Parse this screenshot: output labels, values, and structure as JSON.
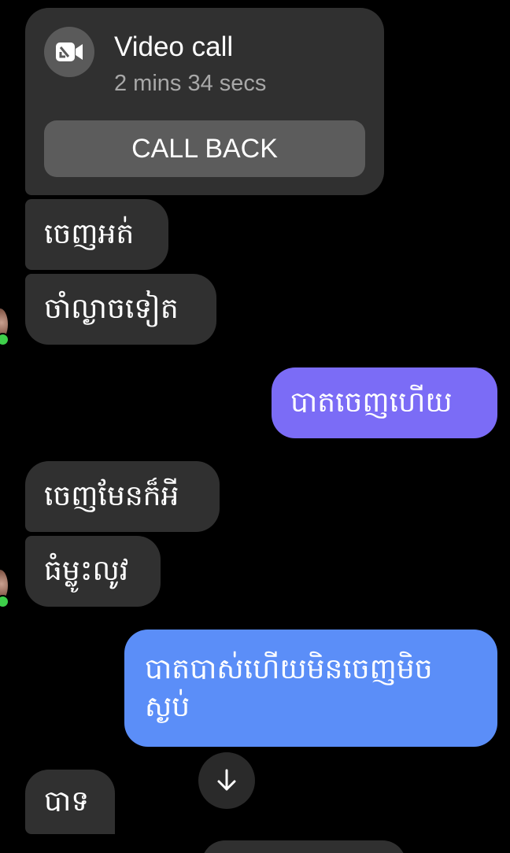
{
  "call_card": {
    "title": "Video call",
    "duration": "2 mins 34 secs",
    "call_back_label": "CALL BACK",
    "icon": "missed-video-call-icon"
  },
  "messages": [
    {
      "direction": "incoming",
      "text": "ចេញអត់"
    },
    {
      "direction": "incoming",
      "text": "ចាំល្ងាចទៀត"
    },
    {
      "direction": "outgoing",
      "text": "បាតចេញហើយ"
    },
    {
      "direction": "incoming",
      "text": "ចេញមែនក៏អី"
    },
    {
      "direction": "incoming",
      "text": "ធំម្លូះលូវ"
    },
    {
      "direction": "outgoing",
      "text_line1": "បាតបាស់ហើយមិនចេញមិច",
      "text_line2": "ស្ងប់"
    },
    {
      "direction": "incoming",
      "text": "បាទ"
    }
  ],
  "scroll_down": {
    "icon": "arrow-down-icon"
  },
  "colors": {
    "background": "#000000",
    "incoming_bubble": "#303030",
    "outgoing_bubble_purple": "#7b6cf6",
    "outgoing_bubble_blue": "#5b8ef8",
    "online_indicator": "#3ecf4a"
  }
}
